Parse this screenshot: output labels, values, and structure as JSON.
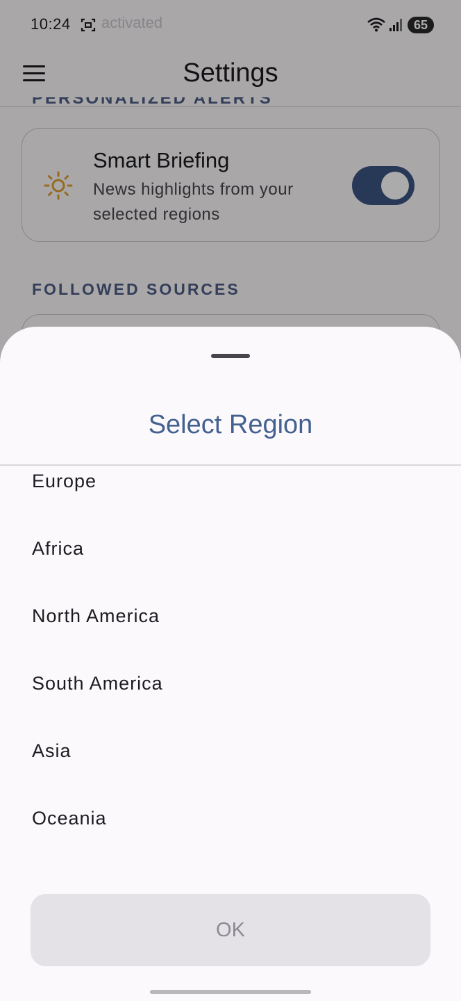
{
  "status_bar": {
    "time": "10:24",
    "ghost_text": "activated",
    "battery": "65"
  },
  "app_bar": {
    "title": "Settings"
  },
  "background": {
    "alerts_heading": "PERSONALIZED ALERTS",
    "briefing": {
      "title": "Smart Briefing",
      "description": "News highlights from your selected regions",
      "toggle_on": true
    },
    "sources_heading": "FOLLOWED SOURCES"
  },
  "sheet": {
    "title": "Select Region",
    "regions": [
      {
        "label": "Europe"
      },
      {
        "label": "Africa"
      },
      {
        "label": "North America"
      },
      {
        "label": "South America"
      },
      {
        "label": "Asia"
      },
      {
        "label": "Oceania"
      }
    ],
    "ok_label": "OK"
  },
  "colors": {
    "accent": "#43618f",
    "toggle": "#3d5684",
    "sun": "#e0a030"
  }
}
